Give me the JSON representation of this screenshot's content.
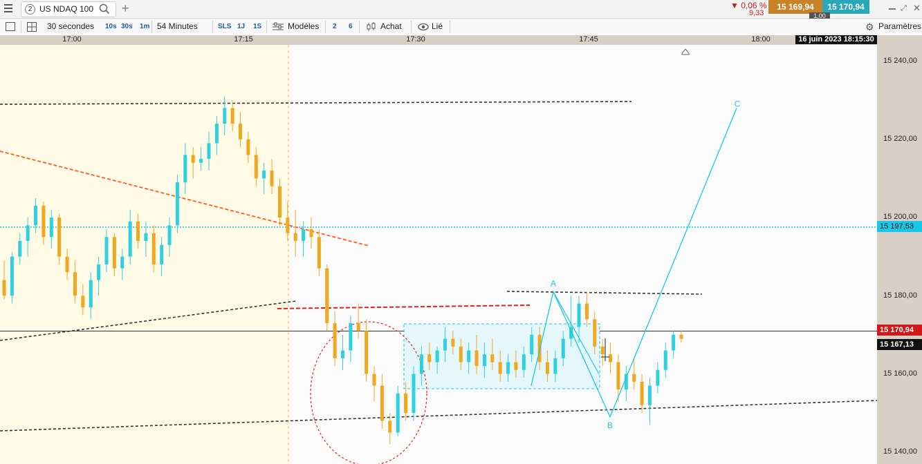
{
  "topbar": {
    "tab_number": "2",
    "instrument": "US NDAQ 100",
    "change_pct": "▼ 0,06 %",
    "change_abs": "9,33",
    "sell_price": "15 169,94",
    "buy_price": "15 170,94",
    "quantity": "1,00",
    "icons": [
      "menu-icon",
      "search-icon",
      "add-tab-icon",
      "minimize-icon",
      "detach-icon",
      "close-icon"
    ]
  },
  "toolbar": {
    "timeframe": "30 secondes",
    "tf_10s": "10s",
    "tf_30s": "30s",
    "tf_1m": "1m",
    "range": "54 Minutes",
    "sls": "SLS",
    "r_1j": "1J",
    "r_1s": "1S",
    "models": "Modèles",
    "n2": "2",
    "n6": "6",
    "buy": "Achat",
    "linked": "Lié",
    "settings": "Paramètres"
  },
  "time_axis": {
    "labels": [
      "17:00",
      "17:15",
      "17:30",
      "17:45",
      "18:00"
    ],
    "current_date": "16 juin 2023 18:15:30"
  },
  "price_axis": {
    "labels": [
      "15 240,00",
      "15 220,00",
      "15 200,00",
      "15 180,00",
      "15 160,00",
      "15 140,00"
    ],
    "marker_cyan": "15 197,53",
    "marker_last": "15 170,94",
    "marker_current": "15 167,13"
  },
  "annotations": {
    "point_a": "A",
    "point_b": "B",
    "point_c": "C"
  },
  "colors": {
    "bull": "#2fd0e0",
    "bear": "#f0a820",
    "session_bg": "#fffbe6",
    "price_axis_bg": "#d8cfc6",
    "accent_red": "#e02020",
    "accent_orange": "#ff5a1a",
    "cyan_level": "#18c8e8"
  },
  "chart_data": {
    "type": "candlestick",
    "instrument": "US NDAQ 100",
    "interval": "30 secondes",
    "x_ticks": [
      "17:00",
      "17:15",
      "17:30",
      "17:45",
      "18:00"
    ],
    "ylim": [
      15138,
      15245
    ],
    "y_ticks": [
      15140,
      15160,
      15180,
      15200,
      15220,
      15240
    ],
    "candles": [
      [
        15184,
        15189,
        15179,
        15180
      ],
      [
        15180,
        15191,
        15178,
        15190
      ],
      [
        15190,
        15196,
        15188,
        15194
      ],
      [
        15194,
        15200,
        15190,
        15198
      ],
      [
        15198,
        15205,
        15196,
        15203
      ],
      [
        15203,
        15204,
        15193,
        15195
      ],
      [
        15195,
        15202,
        15192,
        15200
      ],
      [
        15200,
        15201,
        15188,
        15190
      ],
      [
        15190,
        15192,
        15184,
        15186
      ],
      [
        15186,
        15189,
        15178,
        15180
      ],
      [
        15180,
        15183,
        15175,
        15177
      ],
      [
        15177,
        15186,
        15174,
        15184
      ],
      [
        15184,
        15190,
        15180,
        15188
      ],
      [
        15188,
        15197,
        15186,
        15195
      ],
      [
        15195,
        15196,
        15185,
        15187
      ],
      [
        15187,
        15192,
        15184,
        15190
      ],
      [
        15190,
        15202,
        15188,
        15199
      ],
      [
        15199,
        15201,
        15192,
        15194
      ],
      [
        15194,
        15199,
        15190,
        15196
      ],
      [
        15196,
        15198,
        15186,
        15188
      ],
      [
        15188,
        15195,
        15185,
        15193
      ],
      [
        15193,
        15200,
        15190,
        15198
      ],
      [
        15198,
        15211,
        15196,
        15209
      ],
      [
        15209,
        15219,
        15206,
        15216
      ],
      [
        15216,
        15218,
        15210,
        15214
      ],
      [
        15214,
        15218,
        15212,
        15215
      ],
      [
        15215,
        15222,
        15212,
        15219
      ],
      [
        15219,
        15226,
        15216,
        15224
      ],
      [
        15224,
        15231,
        15221,
        15228
      ],
      [
        15228,
        15230,
        15222,
        15224
      ],
      [
        15224,
        15227,
        15218,
        15220
      ],
      [
        15220,
        15222,
        15214,
        15216
      ],
      [
        15216,
        15218,
        15208,
        15210
      ],
      [
        15210,
        15214,
        15206,
        15212
      ],
      [
        15212,
        15215,
        15206,
        15208
      ],
      [
        15208,
        15210,
        15198,
        15200
      ],
      [
        15200,
        15204,
        15194,
        15196
      ],
      [
        15196,
        15202,
        15190,
        15194
      ],
      [
        15194,
        15199,
        15190,
        15197
      ],
      [
        15197,
        15200,
        15192,
        15195
      ],
      [
        15195,
        15197,
        15185,
        15187
      ],
      [
        15187,
        15188,
        15171,
        15173
      ],
      [
        15173,
        15176,
        15162,
        15164
      ],
      [
        15164,
        15170,
        15161,
        15166
      ],
      [
        15166,
        15175,
        15163,
        15173
      ],
      [
        15173,
        15178,
        15169,
        15171
      ],
      [
        15171,
        15174,
        15158,
        15160
      ],
      [
        15160,
        15162,
        15153,
        15157
      ],
      [
        15157,
        15160,
        15146,
        15148
      ],
      [
        15148,
        15150,
        15142,
        15145
      ],
      [
        15145,
        15157,
        15144,
        15155
      ],
      [
        15155,
        15158,
        15148,
        15150
      ],
      [
        15150,
        15162,
        15148,
        15160
      ],
      [
        15160,
        15167,
        15157,
        15165
      ],
      [
        15165,
        15168,
        15161,
        15163
      ],
      [
        15163,
        15167,
        15160,
        15166
      ],
      [
        15166,
        15172,
        15163,
        15169
      ],
      [
        15169,
        15171,
        15165,
        15167
      ],
      [
        15167,
        15169,
        15161,
        15163
      ],
      [
        15163,
        15168,
        15160,
        15166
      ],
      [
        15166,
        15170,
        15160,
        15162
      ],
      [
        15162,
        15168,
        15159,
        15165
      ],
      [
        15165,
        15169,
        15161,
        15163
      ],
      [
        15163,
        15166,
        15158,
        15160
      ],
      [
        15160,
        15165,
        15158,
        15163
      ],
      [
        15163,
        15166,
        15159,
        15161
      ],
      [
        15161,
        15167,
        15159,
        15165
      ],
      [
        15165,
        15172,
        15163,
        15170
      ],
      [
        15170,
        15172,
        15161,
        15163
      ],
      [
        15163,
        15166,
        15158,
        15160
      ],
      [
        15160,
        15166,
        15158,
        15164
      ],
      [
        15164,
        15171,
        15162,
        15169
      ],
      [
        15169,
        15180,
        15167,
        15172
      ],
      [
        15172,
        15180,
        15168,
        15178
      ],
      [
        15178,
        15181,
        15172,
        15174
      ],
      [
        15174,
        15176,
        15165,
        15167
      ],
      [
        15167,
        15169,
        15162,
        15165
      ],
      [
        15165,
        15168,
        15160,
        15163
      ],
      [
        15163,
        15165,
        15153,
        15156
      ],
      [
        15156,
        15162,
        15153,
        15160
      ],
      [
        15160,
        15164,
        15156,
        15158
      ],
      [
        15158,
        15160,
        15150,
        15152
      ],
      [
        15152,
        15159,
        15147,
        15157
      ],
      [
        15157,
        15163,
        15155,
        15161
      ],
      [
        15161,
        15168,
        15159,
        15166
      ],
      [
        15166,
        15171,
        15164,
        15170
      ],
      [
        15170,
        15171,
        15168,
        15169
      ]
    ],
    "levels": [
      {
        "price": 15197.53,
        "label": "15 197,53"
      },
      {
        "price": 15170.94,
        "label": "15 170,94"
      },
      {
        "price": 15167.13,
        "label": "15 167,13"
      }
    ],
    "abc_pattern": [
      {
        "label": "A",
        "price": 15181
      },
      {
        "label": "B",
        "price": 15149
      },
      {
        "label": "C",
        "price": 15228
      }
    ]
  }
}
